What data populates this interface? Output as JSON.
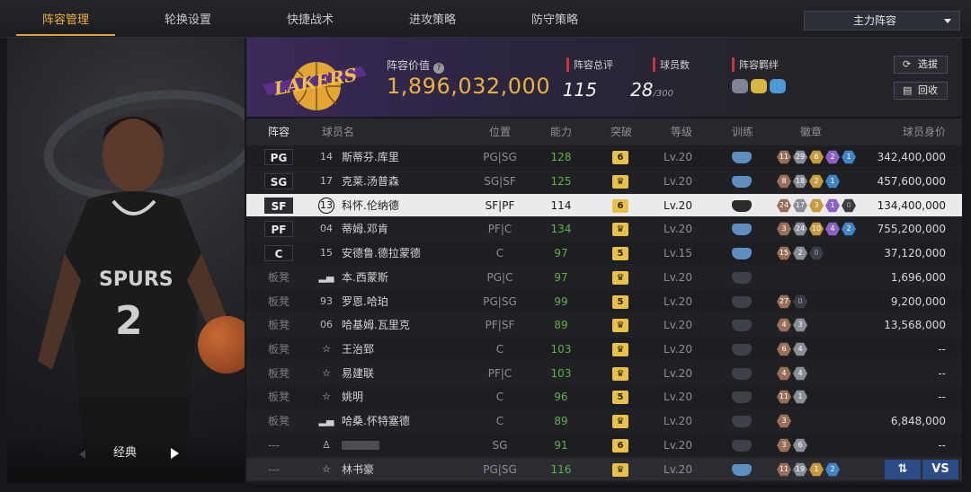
{
  "tabs": [
    "阵容管理",
    "轮换设置",
    "快捷战术",
    "进攻策略",
    "防守策略"
  ],
  "lineup_dropdown": "主力阵容",
  "hero": {
    "mode_label": "经典"
  },
  "team": {
    "value_label": "阵容价值",
    "value": "1,896,032,000",
    "rating_label": "阵容总评",
    "rating": "115",
    "count_label": "球员数",
    "count": "28",
    "count_max": "/300",
    "bond_label": "阵容羁绊",
    "btn_draft": "选拔",
    "btn_return": "回收"
  },
  "columns": {
    "lineup": "阵容",
    "name": "球员名",
    "position": "位置",
    "ability": "能力",
    "breakthrough": "突破",
    "level": "等级",
    "training": "训练",
    "badges": "徽章",
    "value": "球员身价"
  },
  "colors": {
    "accent": "#e0a432",
    "ability_green": "#5fb148",
    "break_gold": "#e8c148",
    "selected_row": "#ebebeb"
  },
  "players": [
    {
      "slot": "PG",
      "num": "14",
      "name": "斯蒂芬.库里",
      "pos": "PG|SG",
      "ability": "128",
      "brk": "6",
      "level": "Lv.20",
      "train": "blue",
      "badges": [
        [
          "b",
          "11"
        ],
        [
          "s",
          "29"
        ],
        [
          "g",
          "6"
        ],
        [
          "p",
          "2"
        ],
        [
          "c",
          "1"
        ]
      ],
      "value": "342,400,000"
    },
    {
      "slot": "SG",
      "num": "17",
      "name": "克莱.汤普森",
      "pos": "SG|SF",
      "ability": "125",
      "brk": "crown",
      "level": "Lv.20",
      "train": "blue",
      "badges": [
        [
          "b",
          "8"
        ],
        [
          "s",
          "18"
        ],
        [
          "g",
          "2"
        ],
        [
          "c",
          "1"
        ]
      ],
      "value": "457,600,000"
    },
    {
      "slot": "SF",
      "num": "13",
      "name": "科怀.伦纳德",
      "pos": "SF|PF",
      "ability": "114",
      "brk": "6",
      "level": "Lv.20",
      "train": "dark",
      "badges": [
        [
          "b",
          "24"
        ],
        [
          "s",
          "17"
        ],
        [
          "g",
          "3"
        ],
        [
          "p",
          "1"
        ],
        [
          "d",
          "0"
        ]
      ],
      "value": "134,400,000",
      "selected": true
    },
    {
      "slot": "PF",
      "num": "04",
      "name": "蒂姆.邓肯",
      "pos": "PF|C",
      "ability": "134",
      "brk": "crown",
      "level": "Lv.20",
      "train": "blue",
      "badges": [
        [
          "b",
          "3"
        ],
        [
          "s",
          "24"
        ],
        [
          "g",
          "10"
        ],
        [
          "p",
          "4"
        ],
        [
          "c",
          "2"
        ]
      ],
      "value": "755,200,000"
    },
    {
      "slot": "C",
      "num": "15",
      "name": "安德鲁.德拉蒙德",
      "pos": "C",
      "ability": "97",
      "brk": "5",
      "level": "Lv.15",
      "train": "blue",
      "badges": [
        [
          "b",
          "15"
        ],
        [
          "s",
          "2"
        ],
        [
          "d",
          "0"
        ]
      ],
      "value": "37,120,000"
    },
    {
      "slot": "板凳",
      "num": "sig",
      "name": "本.西蒙斯",
      "pos": "PG|C",
      "ability": "97",
      "brk": "crown",
      "level": "Lv.20",
      "train": "grey",
      "badges": [],
      "value": "1,696,000"
    },
    {
      "slot": "板凳",
      "num": "93",
      "name": "罗恩.哈珀",
      "pos": "PG|SG",
      "ability": "99",
      "brk": "5",
      "level": "Lv.20",
      "train": "grey",
      "badges": [
        [
          "b",
          "27"
        ],
        [
          "d",
          "0"
        ]
      ],
      "value": "9,200,000"
    },
    {
      "slot": "板凳",
      "num": "06",
      "name": "哈基姆.瓦里克",
      "pos": "PF|SF",
      "ability": "89",
      "brk": "crown",
      "level": "Lv.20",
      "train": "grey",
      "badges": [
        [
          "b",
          "4"
        ],
        [
          "s",
          "3"
        ]
      ],
      "value": "13,568,000"
    },
    {
      "slot": "板凳",
      "num": "star",
      "name": "王治郅",
      "pos": "C",
      "ability": "103",
      "brk": "crown",
      "level": "Lv.20",
      "train": "grey",
      "badges": [
        [
          "b",
          "6"
        ],
        [
          "s",
          "4"
        ]
      ],
      "value": "--"
    },
    {
      "slot": "板凳",
      "num": "star",
      "name": "易建联",
      "pos": "PF|C",
      "ability": "103",
      "brk": "crown",
      "level": "Lv.20",
      "train": "grey",
      "badges": [
        [
          "b",
          "4"
        ],
        [
          "s",
          "4"
        ]
      ],
      "value": "--"
    },
    {
      "slot": "板凳",
      "num": "star",
      "name": "姚明",
      "pos": "C",
      "ability": "96",
      "brk": "5",
      "level": "Lv.20",
      "train": "grey",
      "badges": [
        [
          "b",
          "11"
        ],
        [
          "s",
          "1"
        ]
      ],
      "value": "--"
    },
    {
      "slot": "板凳",
      "num": "sig",
      "name": "哈桑.怀特塞德",
      "pos": "C",
      "ability": "89",
      "brk": "crown",
      "level": "Lv.20",
      "train": "grey",
      "badges": [
        [
          "b",
          "3"
        ]
      ],
      "value": "6,848,000"
    },
    {
      "slot": "---",
      "num": "user",
      "name": "",
      "pos": "SG",
      "ability": "91",
      "brk": "6",
      "level": "Lv.20",
      "train": "grey",
      "badges": [
        [
          "b",
          "3"
        ],
        [
          "s",
          "6"
        ]
      ],
      "value": "--"
    },
    {
      "slot": "---",
      "num": "star",
      "name": "林书豪",
      "pos": "PG|SG",
      "ability": "116",
      "brk": "crown",
      "level": "Lv.20",
      "train": "blue",
      "badges": [
        [
          "b",
          "11"
        ],
        [
          "s",
          "19"
        ],
        [
          "g",
          "1"
        ],
        [
          "c",
          "2"
        ]
      ],
      "value": "",
      "foot": true
    }
  ],
  "footer_buttons": {
    "swap": "⇅",
    "vs": "VS"
  }
}
